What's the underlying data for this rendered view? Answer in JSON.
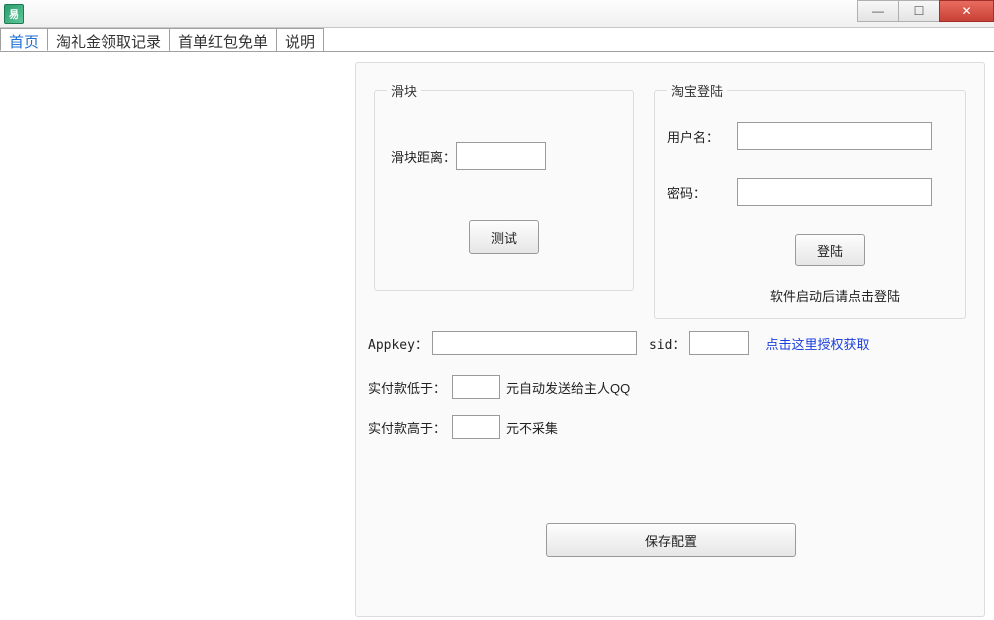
{
  "app_icon_glyph": "易",
  "tabs": {
    "home": "首页",
    "record": "淘礼金领取记录",
    "free": "首单红包免单",
    "help": "说明"
  },
  "slider": {
    "legend": "滑块",
    "distance_label": "滑块距离：",
    "distance_value": "",
    "test_btn": "测试"
  },
  "login": {
    "legend": "淘宝登陆",
    "user_label": "用户名：",
    "user_value": "",
    "pwd_label": "密码：",
    "pwd_value": "",
    "login_btn": "登陆",
    "hint": "软件启动后请点击登陆"
  },
  "api": {
    "appkey_label": "Appkey：",
    "appkey_value": "",
    "sid_label": "sid：",
    "sid_value": "",
    "auth_link": "点击这里授权获取"
  },
  "rules": {
    "low_prefix": "实付款低于：",
    "low_value": "",
    "low_suffix": "元自动发送给主人QQ",
    "high_prefix": "实付款高于：",
    "high_value": "",
    "high_suffix": "元不采集"
  },
  "save_btn": "保存配置"
}
